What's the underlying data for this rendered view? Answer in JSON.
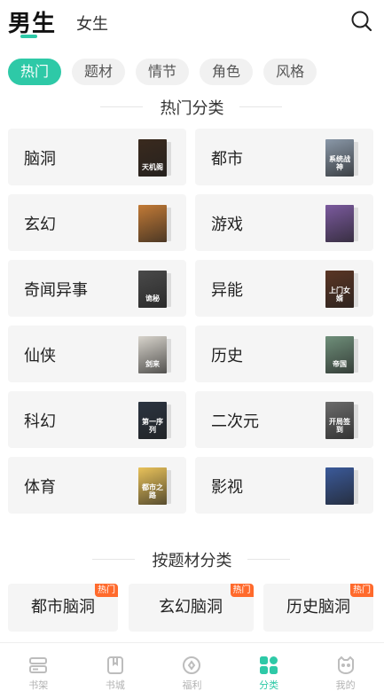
{
  "header": {
    "primary_tab": "男生",
    "secondary_tab": "女生",
    "search_icon": "search-icon"
  },
  "filters": [
    "热门",
    "题材",
    "情节",
    "角色",
    "风格"
  ],
  "active_filter": "热门",
  "hot_section": {
    "title": "热门分类"
  },
  "categories": [
    {
      "label": "脑洞",
      "cover_text": "天机阁",
      "cover_color": "#3a2a1e"
    },
    {
      "label": "都市",
      "cover_text": "系统战神",
      "cover_color": "#8a98a8"
    },
    {
      "label": "玄幻",
      "cover_text": "",
      "cover_color": "#c27a36"
    },
    {
      "label": "游戏",
      "cover_text": "",
      "cover_color": "#7b5a9e"
    },
    {
      "label": "奇闻异事",
      "cover_text": "诡秘",
      "cover_color": "#4a4a4a"
    },
    {
      "label": "异能",
      "cover_text": "上门女婿",
      "cover_color": "#5a3524"
    },
    {
      "label": "仙侠",
      "cover_text": "剑来",
      "cover_color": "#d8d4cc"
    },
    {
      "label": "历史",
      "cover_text": "帝国",
      "cover_color": "#6f8f7a"
    },
    {
      "label": "科幻",
      "cover_text": "第一序列",
      "cover_color": "#2b3440"
    },
    {
      "label": "二次元",
      "cover_text": "开局签到",
      "cover_color": "#6b6b6b"
    },
    {
      "label": "体育",
      "cover_text": "都市之路",
      "cover_color": "#e9c25a"
    },
    {
      "label": "影视",
      "cover_text": "",
      "cover_color": "#3b5a9a"
    }
  ],
  "topic_section": {
    "title": "按题材分类"
  },
  "topics": [
    {
      "label": "都市脑洞",
      "tag": "热门"
    },
    {
      "label": "玄幻脑洞",
      "tag": "热门"
    },
    {
      "label": "历史脑洞",
      "tag": "热门"
    }
  ],
  "nav": [
    {
      "label": "书架",
      "icon": "bookshelf-icon",
      "active": false
    },
    {
      "label": "书城",
      "icon": "bookstore-icon",
      "active": false
    },
    {
      "label": "福利",
      "icon": "welfare-icon",
      "active": false
    },
    {
      "label": "分类",
      "icon": "category-icon",
      "active": true
    },
    {
      "label": "我的",
      "icon": "profile-icon",
      "active": false
    }
  ],
  "colors": {
    "accent": "#2ec9a7",
    "hot_tag": "#ff6a2c",
    "card_bg": "#f5f5f5"
  }
}
